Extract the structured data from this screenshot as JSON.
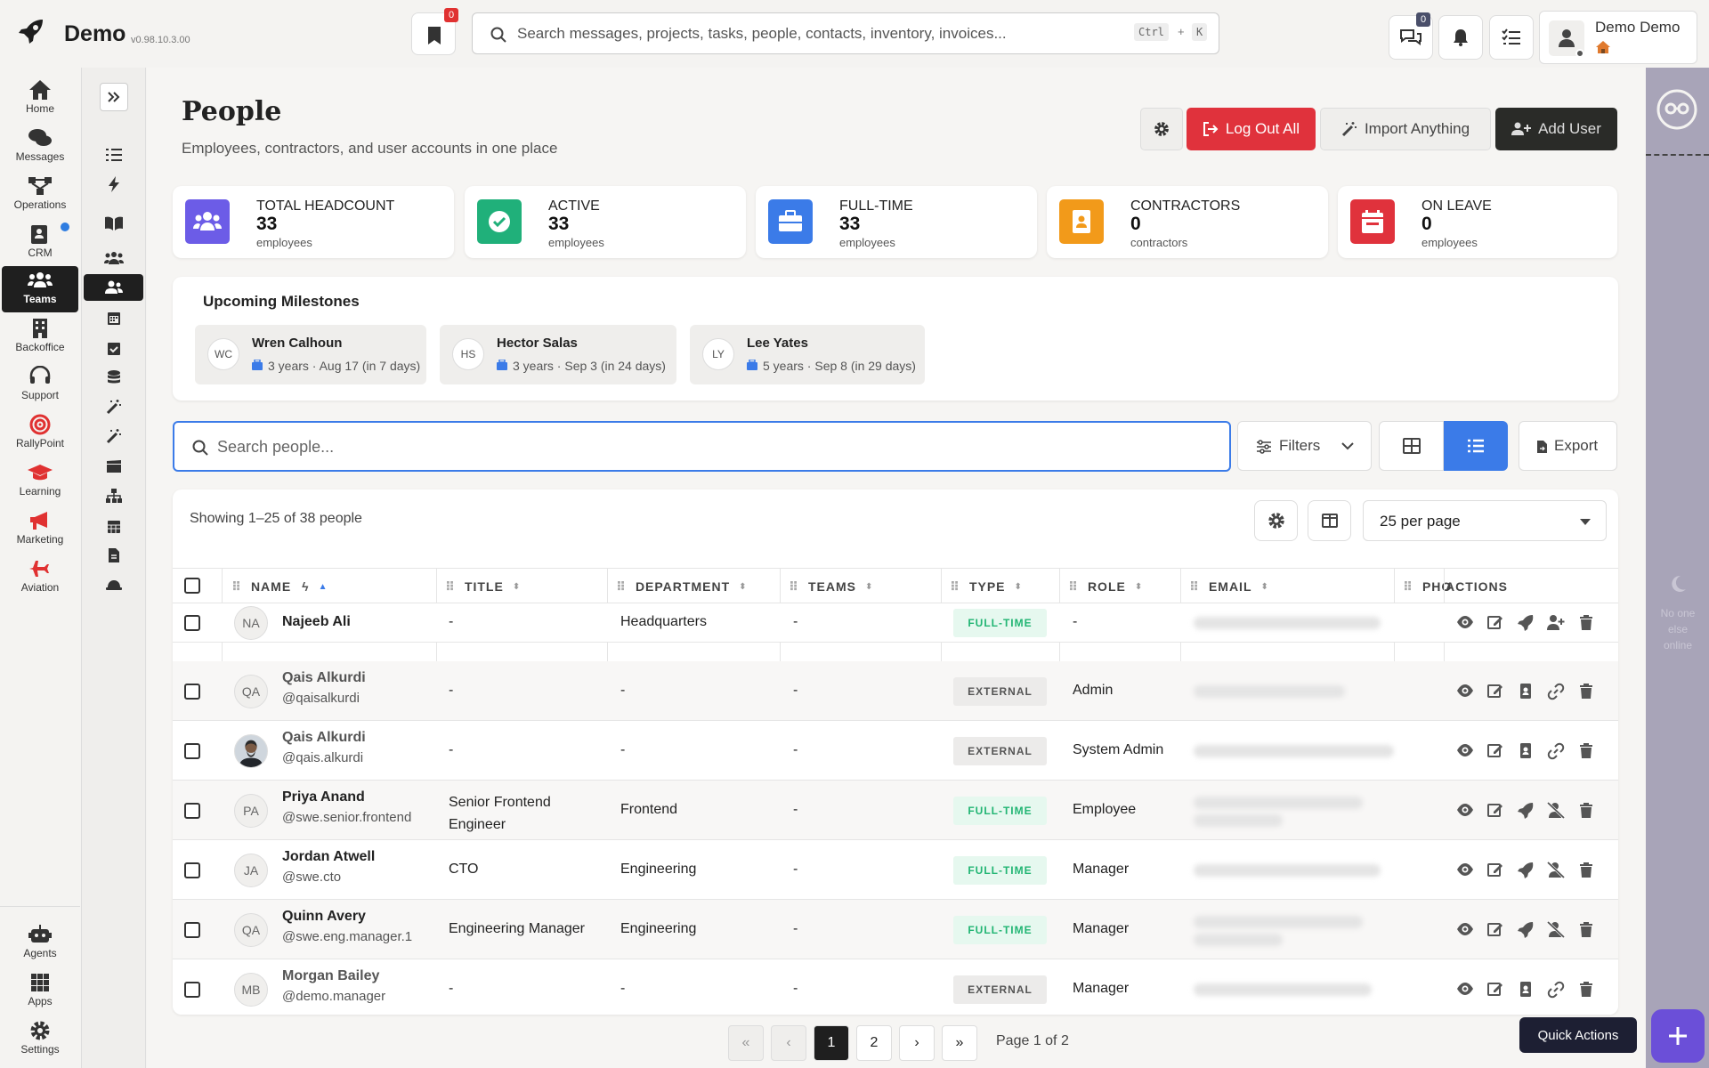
{
  "app": {
    "name": "Demo",
    "version": "v0.98.10.3.00"
  },
  "topbar": {
    "bookmark_count": "0",
    "search_placeholder": "Search messages, projects, tasks, people, contacts, inventory, invoices...",
    "kbd_ctrl": "Ctrl",
    "kbd_plus": "+",
    "kbd_k": "K",
    "messages_count": "0",
    "user_name": "Demo Demo"
  },
  "rail": {
    "items": [
      {
        "label": "Home",
        "icon": "home-icon"
      },
      {
        "label": "Messages",
        "icon": "messages-icon"
      },
      {
        "label": "Operations",
        "icon": "operations-icon"
      },
      {
        "label": "CRM",
        "icon": "crm-icon"
      },
      {
        "label": "Teams",
        "icon": "teams-icon"
      },
      {
        "label": "Backoffice",
        "icon": "building-icon"
      },
      {
        "label": "Support",
        "icon": "headset-icon"
      },
      {
        "label": "RallyPoint",
        "icon": "target-icon"
      },
      {
        "label": "Learning",
        "icon": "graduation-cap-icon"
      },
      {
        "label": "Marketing",
        "icon": "megaphone-icon"
      },
      {
        "label": "Aviation",
        "icon": "plane-icon"
      }
    ],
    "bottom": [
      {
        "label": "Agents",
        "icon": "robot-icon"
      },
      {
        "label": "Apps",
        "icon": "grid-icon"
      },
      {
        "label": "Settings",
        "icon": "gear-icon"
      }
    ],
    "active": "Teams"
  },
  "page": {
    "title": "People",
    "subtitle": "Employees, contractors, and user accounts in one place",
    "buttons": {
      "logout_all": "Log Out All",
      "import": "Import Anything",
      "add_user": "Add User"
    }
  },
  "stats": [
    {
      "label": "TOTAL HEADCOUNT",
      "value": "33",
      "unit": "employees",
      "color": "#6c5ce7",
      "icon": "users-icon"
    },
    {
      "label": "ACTIVE",
      "value": "33",
      "unit": "employees",
      "color": "#20b07a",
      "icon": "check-icon"
    },
    {
      "label": "FULL-TIME",
      "value": "33",
      "unit": "employees",
      "color": "#3b7be8",
      "icon": "briefcase-icon"
    },
    {
      "label": "CONTRACTORS",
      "value": "0",
      "unit": "contractors",
      "color": "#f29a1a",
      "icon": "id-badge-icon"
    },
    {
      "label": "ON LEAVE",
      "value": "0",
      "unit": "employees",
      "color": "#e0323c",
      "icon": "calendar-icon"
    }
  ],
  "milestones": {
    "title": "Upcoming Milestones",
    "items": [
      {
        "initials": "WC",
        "name": "Wren Calhoun",
        "detail": "3 years · Aug 17 (in 7 days)"
      },
      {
        "initials": "HS",
        "name": "Hector Salas",
        "detail": "3 years · Sep 3 (in 24 days)"
      },
      {
        "initials": "LY",
        "name": "Lee Yates",
        "detail": "5 years · Sep 8 (in 29 days)"
      }
    ]
  },
  "toolbar": {
    "search_placeholder": "Search people...",
    "filters": "Filters",
    "export": "Export"
  },
  "table": {
    "showing": "Showing 1–25 of 38 people",
    "per_page": "25 per page",
    "columns": [
      "NAME",
      "TITLE",
      "DEPARTMENT",
      "TEAMS",
      "TYPE",
      "ROLE",
      "EMAIL",
      "PHO",
      "ACTIONS"
    ],
    "rows": [
      {
        "initials": "NA",
        "name": "Najeeb Ali",
        "handle": "",
        "title": "-",
        "title2": "",
        "department": "Headquarters",
        "teams": "-",
        "type": "FULL-TIME",
        "role": "-"
      },
      {
        "initials": "QA",
        "name": "Qais Alkurdi",
        "handle": "@qaisalkurdi",
        "title": "-",
        "title2": "",
        "department": "-",
        "teams": "-",
        "type": "EXTERNAL",
        "role": "Admin"
      },
      {
        "initials": "",
        "name": "Qais Alkurdi",
        "handle": "@qais.alkurdi",
        "title": "-",
        "title2": "",
        "department": "-",
        "teams": "-",
        "type": "EXTERNAL",
        "role": "System Admin"
      },
      {
        "initials": "PA",
        "name": "Priya Anand",
        "handle": "@swe.senior.frontend",
        "title": "Senior Frontend",
        "title2": "Engineer",
        "department": "Frontend",
        "teams": "-",
        "type": "FULL-TIME",
        "role": "Employee"
      },
      {
        "initials": "JA",
        "name": "Jordan Atwell",
        "handle": "@swe.cto",
        "title": "CTO",
        "title2": "",
        "department": "Engineering",
        "teams": "-",
        "type": "FULL-TIME",
        "role": "Manager"
      },
      {
        "initials": "QA",
        "name": "Quinn Avery",
        "handle": "@swe.eng.manager.1",
        "title": "Engineering Manager",
        "title2": "",
        "department": "Engineering",
        "teams": "-",
        "type": "FULL-TIME",
        "role": "Manager"
      },
      {
        "initials": "MB",
        "name": "Morgan Bailey",
        "handle": "@demo.manager",
        "title": "-",
        "title2": "",
        "department": "-",
        "teams": "-",
        "type": "EXTERNAL",
        "role": "Manager"
      }
    ]
  },
  "pagination": {
    "current": "1",
    "next_page": "2",
    "label": "Page 1 of 2"
  },
  "presence": {
    "text": "No one else online"
  },
  "quick_actions": "Quick Actions"
}
